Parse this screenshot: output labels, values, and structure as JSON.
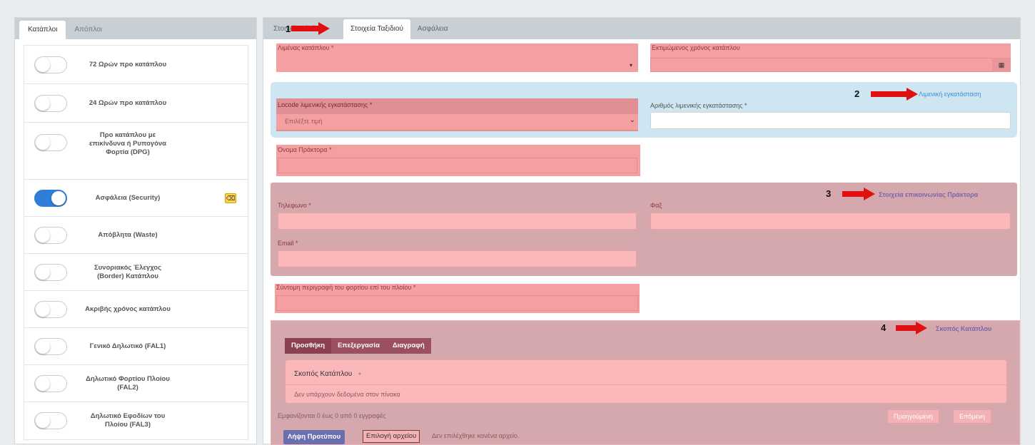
{
  "left": {
    "tabs": [
      "Κατάπλοι",
      "Απόπλοι"
    ],
    "switches": [
      {
        "label": "72 Ωρών προ κατάπλου",
        "on": false
      },
      {
        "label": "24 Ωρών προ κατάπλου",
        "on": false
      },
      {
        "label": "Προ κατάπλου με επικίνδυνα ή Ρυπογόνα Φορτία (DPG)",
        "on": false
      },
      {
        "label": "Ασφάλεια (Security)",
        "on": true
      },
      {
        "label": "Απόβλητα (Waste)",
        "on": false
      },
      {
        "label": "Συνοριακός Έλεγχος (Border) Κατάπλου",
        "on": false
      },
      {
        "label": "Ακριβής χρόνος κατάπλου",
        "on": false
      },
      {
        "label": "Γενικό Δηλωτικό (FAL1)",
        "on": false
      },
      {
        "label": "Δηλωτικό Φορτίου Πλοίου (FAL2)",
        "on": false
      },
      {
        "label": "Δηλωτικό Εφοδίων του Πλοίου (FAL3)",
        "on": false
      }
    ]
  },
  "right": {
    "tabs": [
      "Στοιχεία Πλοίου",
      "Στοιχεία Ταξιδιού",
      "Ασφάλεια"
    ],
    "port_label": "Λιμένας κατάπλου *",
    "eta_label": "Εκτιμώμενος χρόνος κατάπλου",
    "facility_link": "Λιμενική εγκατάσταση",
    "locode_label": "Locode λιμενικής εγκατάστασης *",
    "locode_placeholder": "Επιλέξτε τιμή",
    "facility_number_label": "Αριθμός λιμενικής εγκατάστασης *",
    "agent_name_label": "Όνομα Πράκτορα *",
    "agent_contact_link": "Στοιχεία επικοινωνίας Πράκτορα",
    "phone_label": "Τηλεφωνο *",
    "fax_label": "Φαξ",
    "email_label": "Email *",
    "cargo_label": "Σύντομη περιγραφή του φορτίου επί του πλοίου *",
    "purpose_link": "Σκοπός Κατάπλου",
    "buttons": {
      "add": "Προσθήκη",
      "edit": "Επεξεργασία",
      "delete": "Διαγραφή"
    },
    "table_header": "Σκοπός Κατάπλου",
    "table_empty": "Δεν υπάρχουν δεδομένα στον πίνακα",
    "table_info": "Εμφανίζονται 0 έως 0 από 0 εγγραφές",
    "prev": "Προηγούμενη",
    "next": "Επόμενη",
    "template_button": "Λήψη Προτύπου",
    "file_button": "Επιλογή αρχείου",
    "no_file": "Δεν επιλέχθηκε κανένα αρχείο."
  },
  "annotations": [
    "1",
    "2",
    "3",
    "4"
  ],
  "colors": {
    "toggle_on": "#2f7fd8",
    "arrow": "#e01010",
    "highlight": "#f4a0a2",
    "facility_box": "#cde6f2"
  }
}
